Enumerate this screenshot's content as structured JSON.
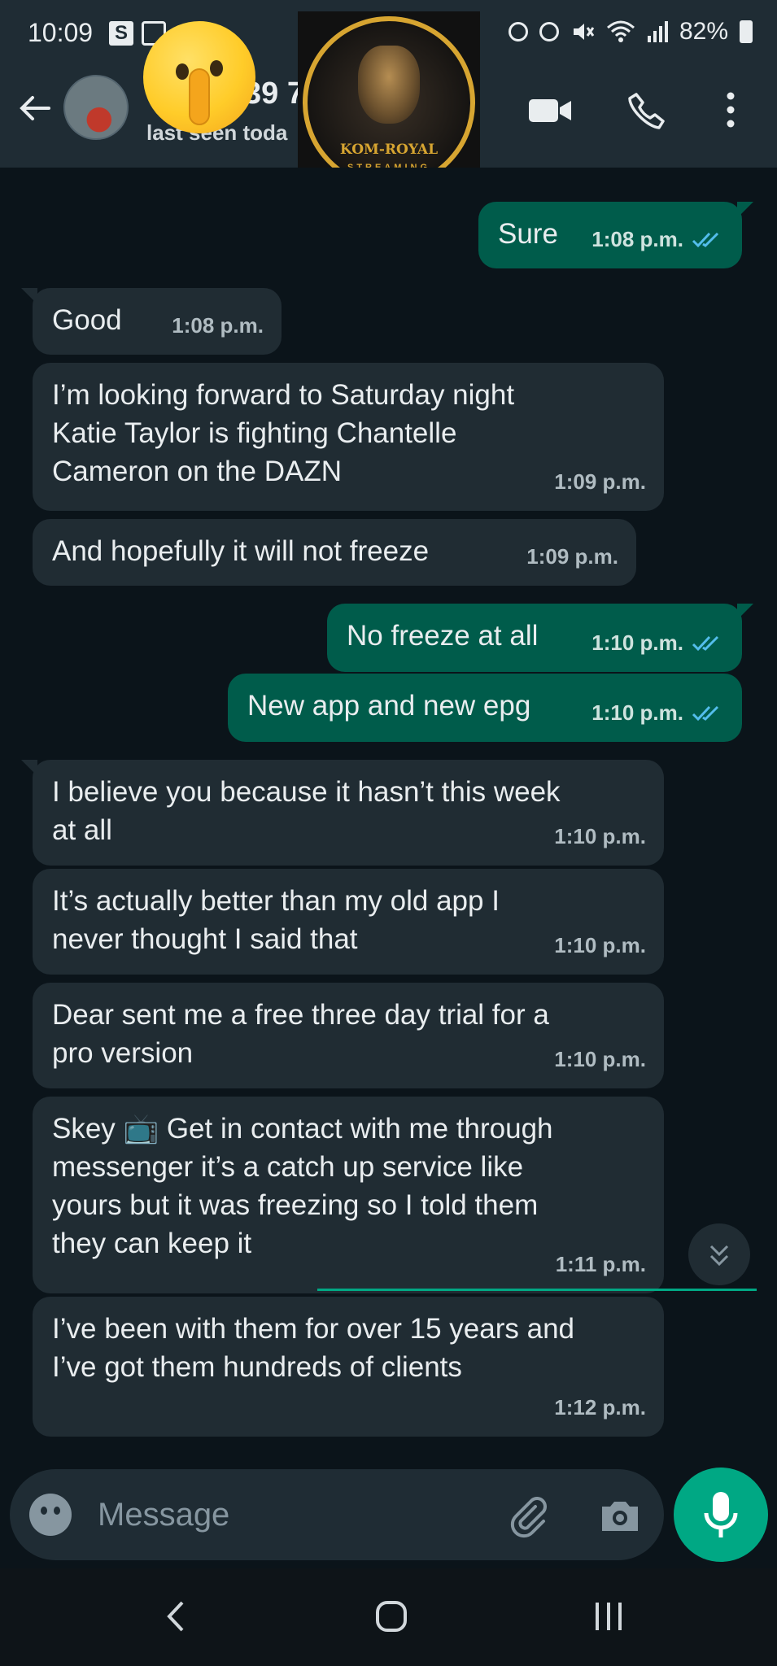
{
  "status_bar": {
    "time": "10:09",
    "battery": "82%"
  },
  "header": {
    "contact_name": "39 7",
    "last_seen": "last seen toda",
    "logo_title": "KOM-ROYAL",
    "logo_subtitle": "STREAMING"
  },
  "messages": [
    {
      "dir": "out",
      "text": "Sure",
      "time": "1:08 p.m."
    },
    {
      "dir": "in",
      "text": "Good",
      "time": "1:08 p.m."
    },
    {
      "dir": "in",
      "text": "I’m looking forward to Saturday night\nKatie Taylor is fighting Chantelle\nCameron on the DAZN",
      "time": "1:09 p.m."
    },
    {
      "dir": "in",
      "text": "And hopefully it will not freeze",
      "time": "1:09 p.m."
    },
    {
      "dir": "out",
      "text": "No freeze at all",
      "time": "1:10 p.m."
    },
    {
      "dir": "out",
      "text": "New app and new epg",
      "time": "1:10 p.m."
    },
    {
      "dir": "in",
      "text": "I believe you because it hasn’t this week\nat all",
      "time": "1:10 p.m."
    },
    {
      "dir": "in",
      "text": "It’s actually better than my old app I\nnever thought I said that",
      "time": "1:10 p.m."
    },
    {
      "dir": "in",
      "text": "Dear sent me a free three day trial for a\npro version",
      "time": "1:10 p.m."
    },
    {
      "dir": "in",
      "text": "Skey 📺 Get in contact with me through\nmessenger it’s a catch up service like\nyours but it was freezing so I told them\nthey can keep it",
      "time": "1:11 p.m."
    },
    {
      "dir": "in",
      "text": "I’ve been with them for over 15 years and\nI’ve got them hundreds of clients",
      "time": "1:12 p.m."
    }
  ],
  "composer": {
    "placeholder": "Message"
  },
  "colors": {
    "incoming": "#202c33",
    "outgoing": "#005c4b",
    "accent": "#00a884",
    "read_ticks": "#53bdeb"
  }
}
